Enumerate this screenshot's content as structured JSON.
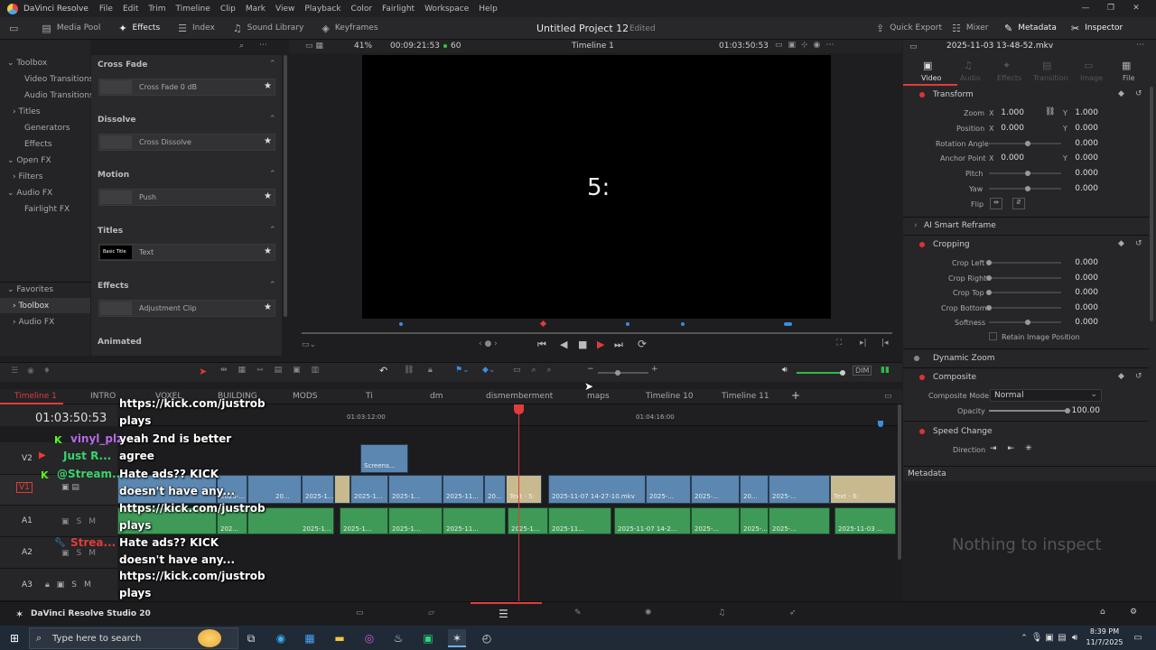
{
  "titlebar": {
    "app": "DaVinci Resolve",
    "menus": [
      "File",
      "Edit",
      "Trim",
      "Timeline",
      "Clip",
      "Mark",
      "View",
      "Playback",
      "Color",
      "Fairlight",
      "Workspace",
      "Help"
    ]
  },
  "toolbar": {
    "left": [
      "Media Pool",
      "Effects",
      "Index",
      "Sound Library",
      "Keyframes"
    ],
    "project": "Untitled Project 12",
    "edited": "Edited",
    "right": [
      "Quick Export",
      "Mixer",
      "Metadata",
      "Inspector"
    ]
  },
  "sidebar": {
    "items": [
      "Toolbox",
      "Video Transitions",
      "Audio Transitions",
      "Titles",
      "Generators",
      "Effects",
      "Open FX",
      "Filters",
      "Audio FX",
      "Fairlight FX"
    ],
    "favorites_header": "Favorites",
    "favorites": [
      "Toolbox",
      "Audio FX"
    ]
  },
  "effects": {
    "groups": [
      {
        "head": "Cross Fade",
        "item": "Cross Fade 0 dB"
      },
      {
        "head": "Dissolve",
        "item": "Cross Dissolve"
      },
      {
        "head": "Motion",
        "item": "Push"
      },
      {
        "head": "Titles",
        "item": "Text",
        "thumb": "Basic Title"
      },
      {
        "head": "Effects",
        "item": "Adjustment Clip"
      },
      {
        "head": "Animated",
        "item": ""
      }
    ]
  },
  "viewer": {
    "zoom": "41%",
    "duration": "00:09:21:53",
    "fps": "60",
    "timeline_name": "Timeline 1",
    "timecode": "01:03:50:53",
    "overlay_text": "5:"
  },
  "timeline": {
    "tabs": [
      "Timeline 1",
      "INTRO",
      "VOXEL",
      "BUILDING",
      "MODS",
      "Ti",
      "dm",
      "dismemberment",
      "maps",
      "Timeline 10",
      "Timeline 11"
    ],
    "current_tc": "01:03:50:53",
    "ruler": [
      "01:03:12:00",
      "01:04:16:00"
    ],
    "tracks": [
      "V2",
      "V1",
      "A1",
      "A2",
      "A3"
    ],
    "v2_clip": "Screens...",
    "v1_clips": [
      "2025-...",
      "20...",
      "2025-1...",
      "2025-1...",
      "2025-1...",
      "2025-11...",
      "20...",
      "Text - 5:",
      "2025-11-07 14-27-10.mkv",
      "2025-...",
      "2025-...",
      "20...",
      "2025-...",
      "Text - 6:"
    ],
    "a1_clips": [
      "202...",
      "2025-1...",
      "2025-1...",
      "2025-1...",
      "2025-11...",
      "2025-1...",
      "2025-11...",
      "2025-11-07 14-2...",
      "2025-...",
      "2025-...",
      "20...",
      "2025-...",
      "2025-11-03 ..."
    ]
  },
  "chat": [
    {
      "text": "https://kick.com/justrob"
    },
    {
      "text": "plays"
    },
    {
      "name": "vinyl_plz",
      "color": "#b46ae8"
    },
    {
      "text": "yeah 2nd is better"
    },
    {
      "name": "Just R...",
      "color": "#39d46a"
    },
    {
      "text": "agree"
    },
    {
      "name": "@Stream...",
      "color": "#39d46a"
    },
    {
      "text": "Hate ads?? KICK"
    },
    {
      "text": "doesn't have any..."
    },
    {
      "text": "https://kick.com/justrob"
    },
    {
      "text": "plays"
    },
    {
      "name": "Strea...",
      "color": "#e03c3c"
    },
    {
      "text": "Hate ads?? KICK"
    },
    {
      "text": "doesn't have any..."
    },
    {
      "text": "https://kick.com/justrob"
    },
    {
      "text": "plays"
    }
  ],
  "inspector": {
    "filename": "2025-11-03 13-48-52.mkv",
    "tabs": [
      "Video",
      "Audio",
      "Effects",
      "Transition",
      "Image",
      "File"
    ],
    "transform_title": "Transform",
    "zoom_label": "Zoom",
    "zoom_x": "1.000",
    "zoom_y": "1.000",
    "position_label": "Position",
    "pos_x": "0.000",
    "pos_y": "0.000",
    "rotation_label": "Rotation Angle",
    "rotation": "0.000",
    "anchor_label": "Anchor Point",
    "anchor_x": "0.000",
    "anchor_y": "0.000",
    "pitch_label": "Pitch",
    "pitch": "0.000",
    "yaw_label": "Yaw",
    "yaw": "0.000",
    "flip_label": "Flip",
    "ai_reframe": "AI Smart Reframe",
    "cropping_title": "Cropping",
    "crop_left_label": "Crop Left",
    "crop_left": "0.000",
    "crop_right_label": "Crop Right",
    "crop_right": "0.000",
    "crop_top_label": "Crop Top",
    "crop_top": "0.000",
    "crop_bottom_label": "Crop Bottom",
    "crop_bottom": "0.000",
    "softness_label": "Softness",
    "softness": "0.000",
    "retain_label": "Retain Image Position",
    "dynamic_zoom": "Dynamic Zoom",
    "composite_title": "Composite",
    "composite_mode_label": "Composite Mode",
    "composite_mode": "Normal",
    "opacity_label": "Opacity",
    "opacity": "100.00",
    "speed_title": "Speed Change",
    "direction_label": "Direction"
  },
  "metadata": {
    "title": "Metadata",
    "empty": "Nothing to inspect"
  },
  "pagebar": {
    "studio": "DaVinci Resolve Studio 20"
  },
  "taskbar": {
    "search_placeholder": "Type here to search",
    "time": "8:39 PM",
    "date": "11/7/2025"
  },
  "colors": {
    "accent_red": "#e13b3b",
    "clip_blue": "#5b87b0",
    "clip_green": "#3f9a58",
    "bg": "#1e1e20"
  }
}
